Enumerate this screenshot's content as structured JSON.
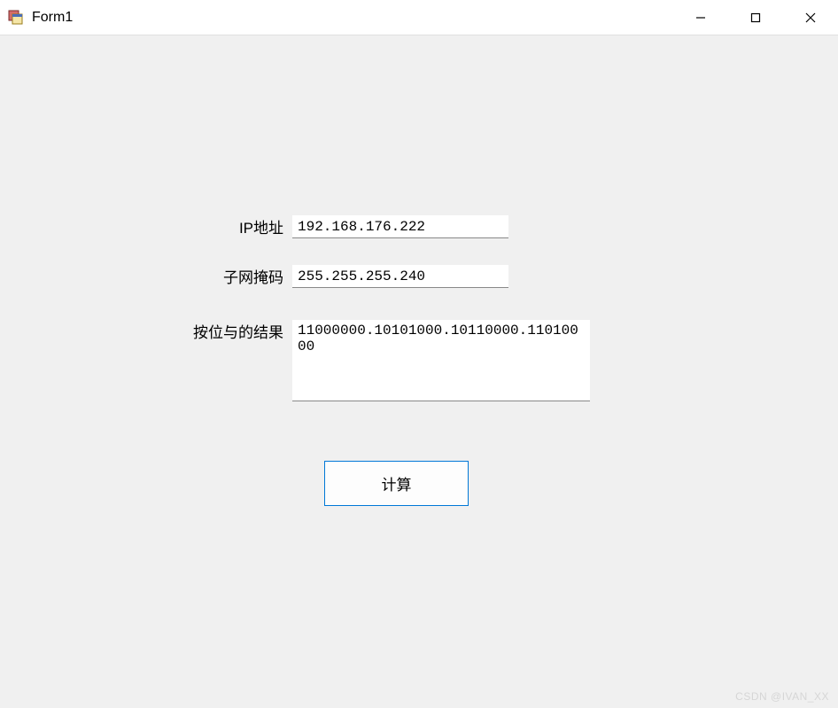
{
  "window": {
    "title": "Form1"
  },
  "labels": {
    "ip": "IP地址",
    "mask": "子网掩码",
    "result": "按位与的结果"
  },
  "fields": {
    "ip_value": "192.168.176.222",
    "mask_value": "255.255.255.240",
    "result_value": "11000000.10101000.10110000.11010000"
  },
  "buttons": {
    "calculate": "计算"
  },
  "watermark": "CSDN @IVAN_XX"
}
